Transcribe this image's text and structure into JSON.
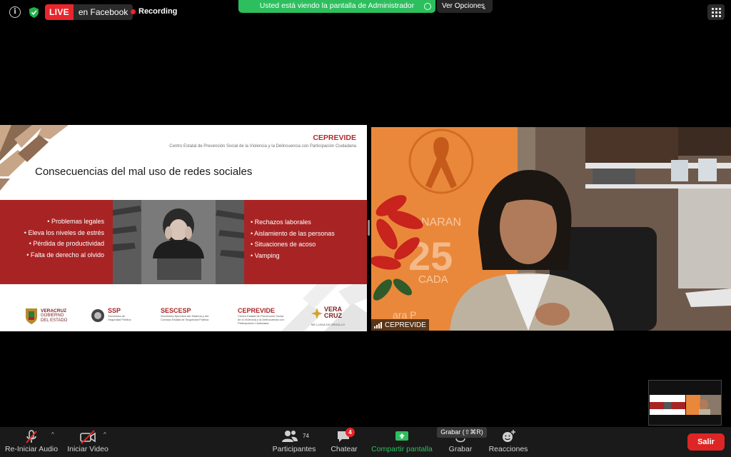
{
  "topbar": {
    "live_badge": "LIVE",
    "live_destination": "en Facebook",
    "recording_label": "Recording",
    "share_banner": "Usted está viendo la pantalla de Administrador",
    "view_options": "Ver Opciones",
    "view_options_chevron": "⌄"
  },
  "slide": {
    "org_title": "CEPREVIDE",
    "org_subtitle": "Centro Estatal de Prevención Social de la Violencia y la Delincuencia con Participación Ciudadana",
    "heading": "Consecuencias del mal uso de redes sociales",
    "bullets_left": [
      "Problemas legales",
      "Eleva los niveles de estrés",
      "Pérdida de productividad",
      "Falta de derecho al olvido"
    ],
    "bullets_right": [
      "Rechazos laborales",
      "Aislamiento de las personas",
      "Situaciones de acoso",
      "Vamping"
    ],
    "logos": {
      "veracruz": {
        "title": "VERACRUZ",
        "sub1": "GOBIERNO",
        "sub2": "DEL ESTADO"
      },
      "ssp": {
        "title": "SSP",
        "sub1": "Secretaría de",
        "sub2": "Seguridad Pública"
      },
      "sescesp": {
        "title": "SESCESP",
        "sub1": "Secretaría Ejecutiva del Sistema y del",
        "sub2": "Consejo Estatal de Seguridad Pública"
      },
      "ceprevide": {
        "title": "CEPREVIDE",
        "sub1": "Centro Estatal de Prevención Social",
        "sub2": "de la Violencia y la Delincuencia con",
        "sub3": "Participación Ciudadana"
      },
      "veracruz_brand": {
        "title1": "VERA",
        "title2": "CRUZ",
        "sub": "ME LLENA DE ORGULLO"
      }
    }
  },
  "video": {
    "participant_name": "CEPREVIDE",
    "background_text_1": "NARAN",
    "background_text_2": "25",
    "background_text_3": "CADA",
    "background_text_4": "ara P"
  },
  "toolbar": {
    "audio_label": "Re-Iniciar Audio",
    "video_label": "Iniciar Video",
    "participants_label": "Participantes",
    "participants_count": "74",
    "chat_label": "Chatear",
    "chat_badge": "4",
    "share_label": "Compartir pantalla",
    "record_label": "Grabar",
    "record_tooltip": "Grabar (⇧⌘R)",
    "reactions_label": "Reacciones",
    "leave_label": "Salir"
  },
  "colors": {
    "share_green": "#2dbf5e",
    "live_red": "#e8262b",
    "slide_red": "#a82424"
  }
}
